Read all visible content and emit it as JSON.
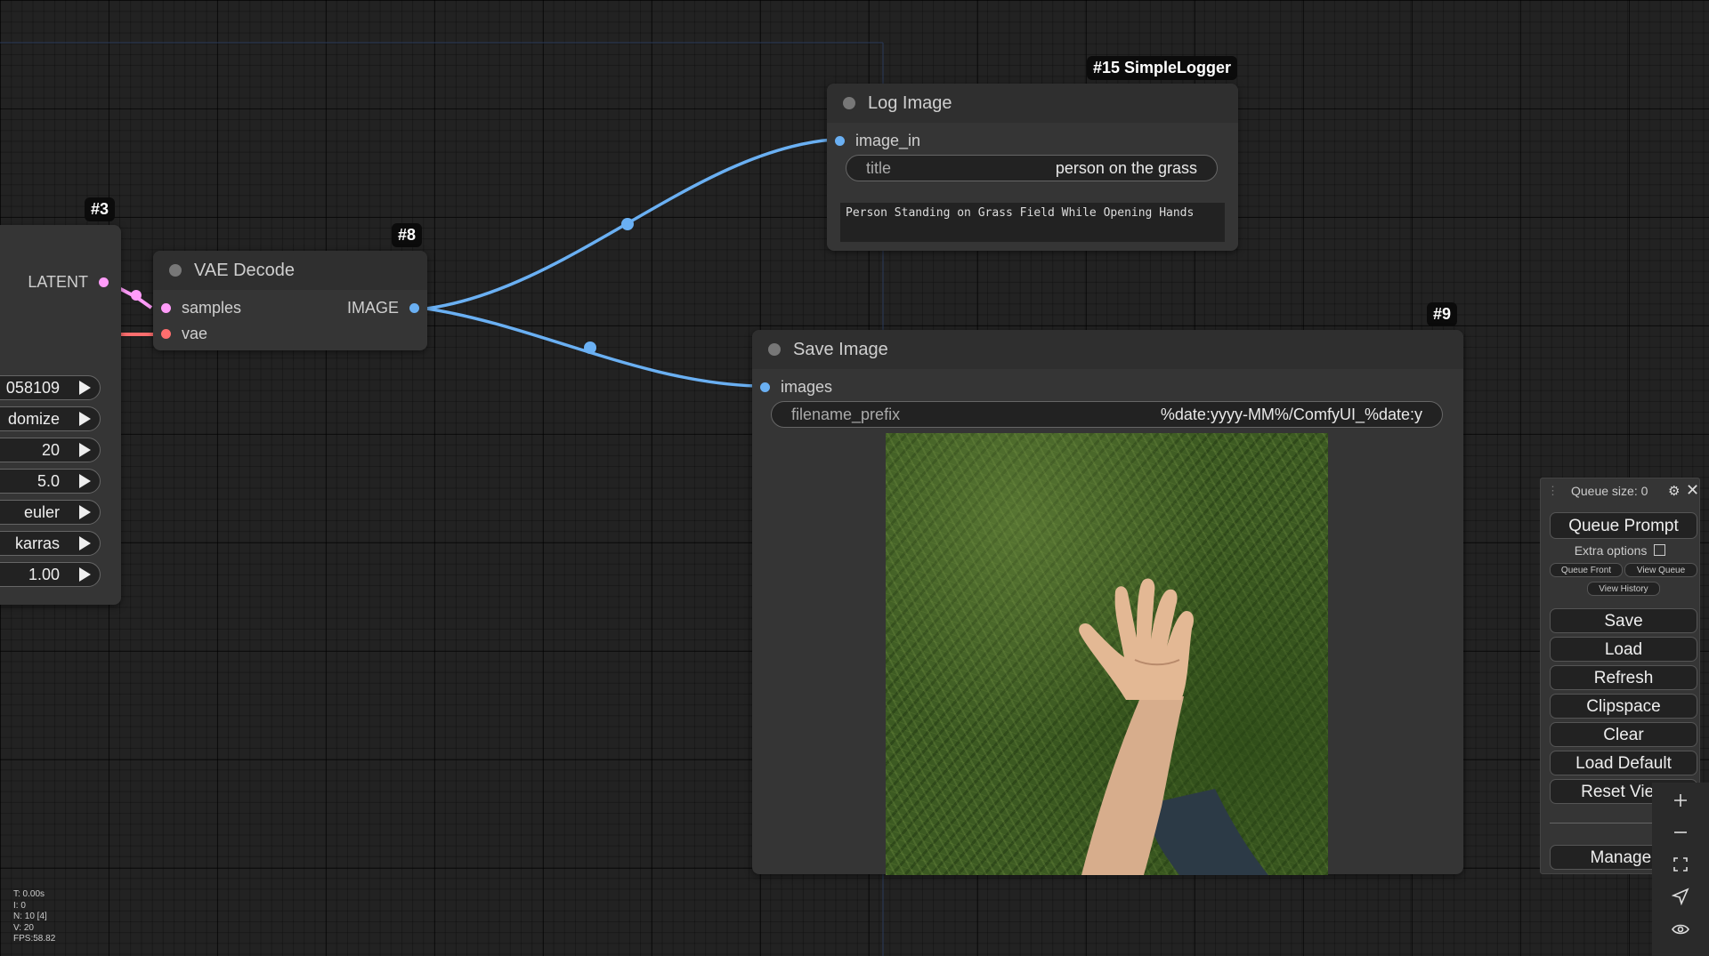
{
  "ksampler": {
    "badge": "#3",
    "output_label": "LATENT",
    "widgets": [
      "058109",
      "domize",
      "20",
      "5.0",
      "euler",
      "karras",
      "1.00"
    ]
  },
  "vae_decode": {
    "badge": "#8",
    "title": "VAE Decode",
    "inputs": [
      "samples",
      "vae"
    ],
    "output_label": "IMAGE"
  },
  "log_image": {
    "badge": "#15 SimpleLogger",
    "title": "Log Image",
    "input": "image_in",
    "title_widget_label": "title",
    "title_widget_value": "person on the grass",
    "text": "Person Standing on Grass Field While Opening Hands"
  },
  "save_image": {
    "badge": "#9",
    "title": "Save Image",
    "input": "images",
    "prefix_label": "filename_prefix",
    "prefix_value": "%date:yyyy-MM%/ComfyUI_%date:y"
  },
  "queue_panel": {
    "queue_size": "Queue size: 0",
    "queue_prompt": "Queue Prompt",
    "extra_options": "Extra options",
    "queue_front": "Queue Front",
    "view_queue": "View Queue",
    "view_history": "View History",
    "buttons": [
      "Save",
      "Load",
      "Refresh",
      "Clipspace",
      "Clear",
      "Load Default",
      "Reset View"
    ],
    "manager": "Manager"
  },
  "stats": [
    "T: 0.00s",
    "I: 0",
    "N: 10 [4]",
    "V: 20",
    "FPS:58.82"
  ],
  "colors": {
    "image_link": "#6ab0f3",
    "latent_link": "#ff9cf9",
    "vae_link": "#ff6e6e",
    "canvas": "#222222"
  },
  "icons": [
    "gear-icon",
    "close-icon",
    "zoom-in-icon",
    "zoom-out-icon",
    "fit-view-icon",
    "pointer-icon",
    "eye-icon"
  ]
}
